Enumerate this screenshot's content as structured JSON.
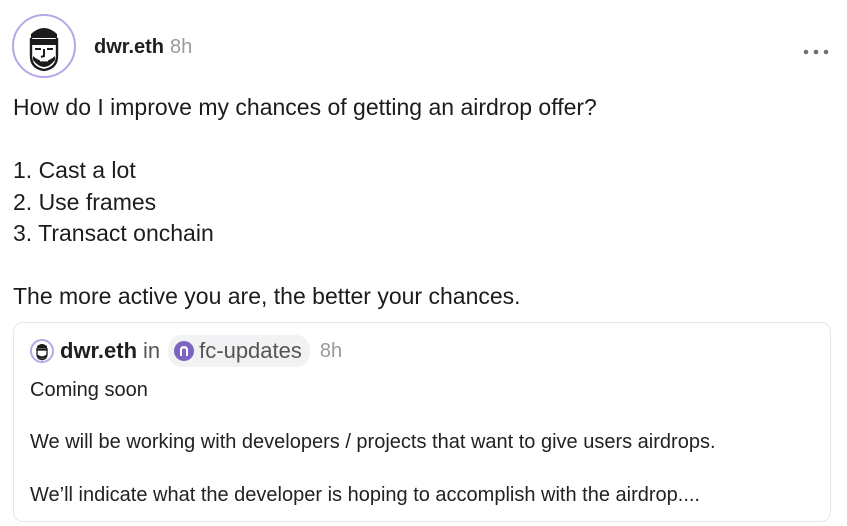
{
  "post": {
    "author": "dwr.eth",
    "time": "8h",
    "more_icon": "ellipsis-icon",
    "lines": [
      "How do I improve my chances of getting an airdrop offer?",
      "1. Cast a lot",
      "2. Use frames",
      "3. Transact onchain",
      "The more active you are, the better your chances."
    ]
  },
  "quote": {
    "author": "dwr.eth",
    "in_label": "in",
    "channel": "fc-updates",
    "time": "8h",
    "lines": [
      "Coming soon",
      "We will be working with developers / projects that want to give users airdrops.",
      "We’ll indicate what the developer is hoping to accomplish with the airdrop...."
    ]
  },
  "colors": {
    "avatar_ring": "#b9a6e6",
    "channel_accent": "#7c65c1",
    "muted_text": "#9a9a9a"
  }
}
